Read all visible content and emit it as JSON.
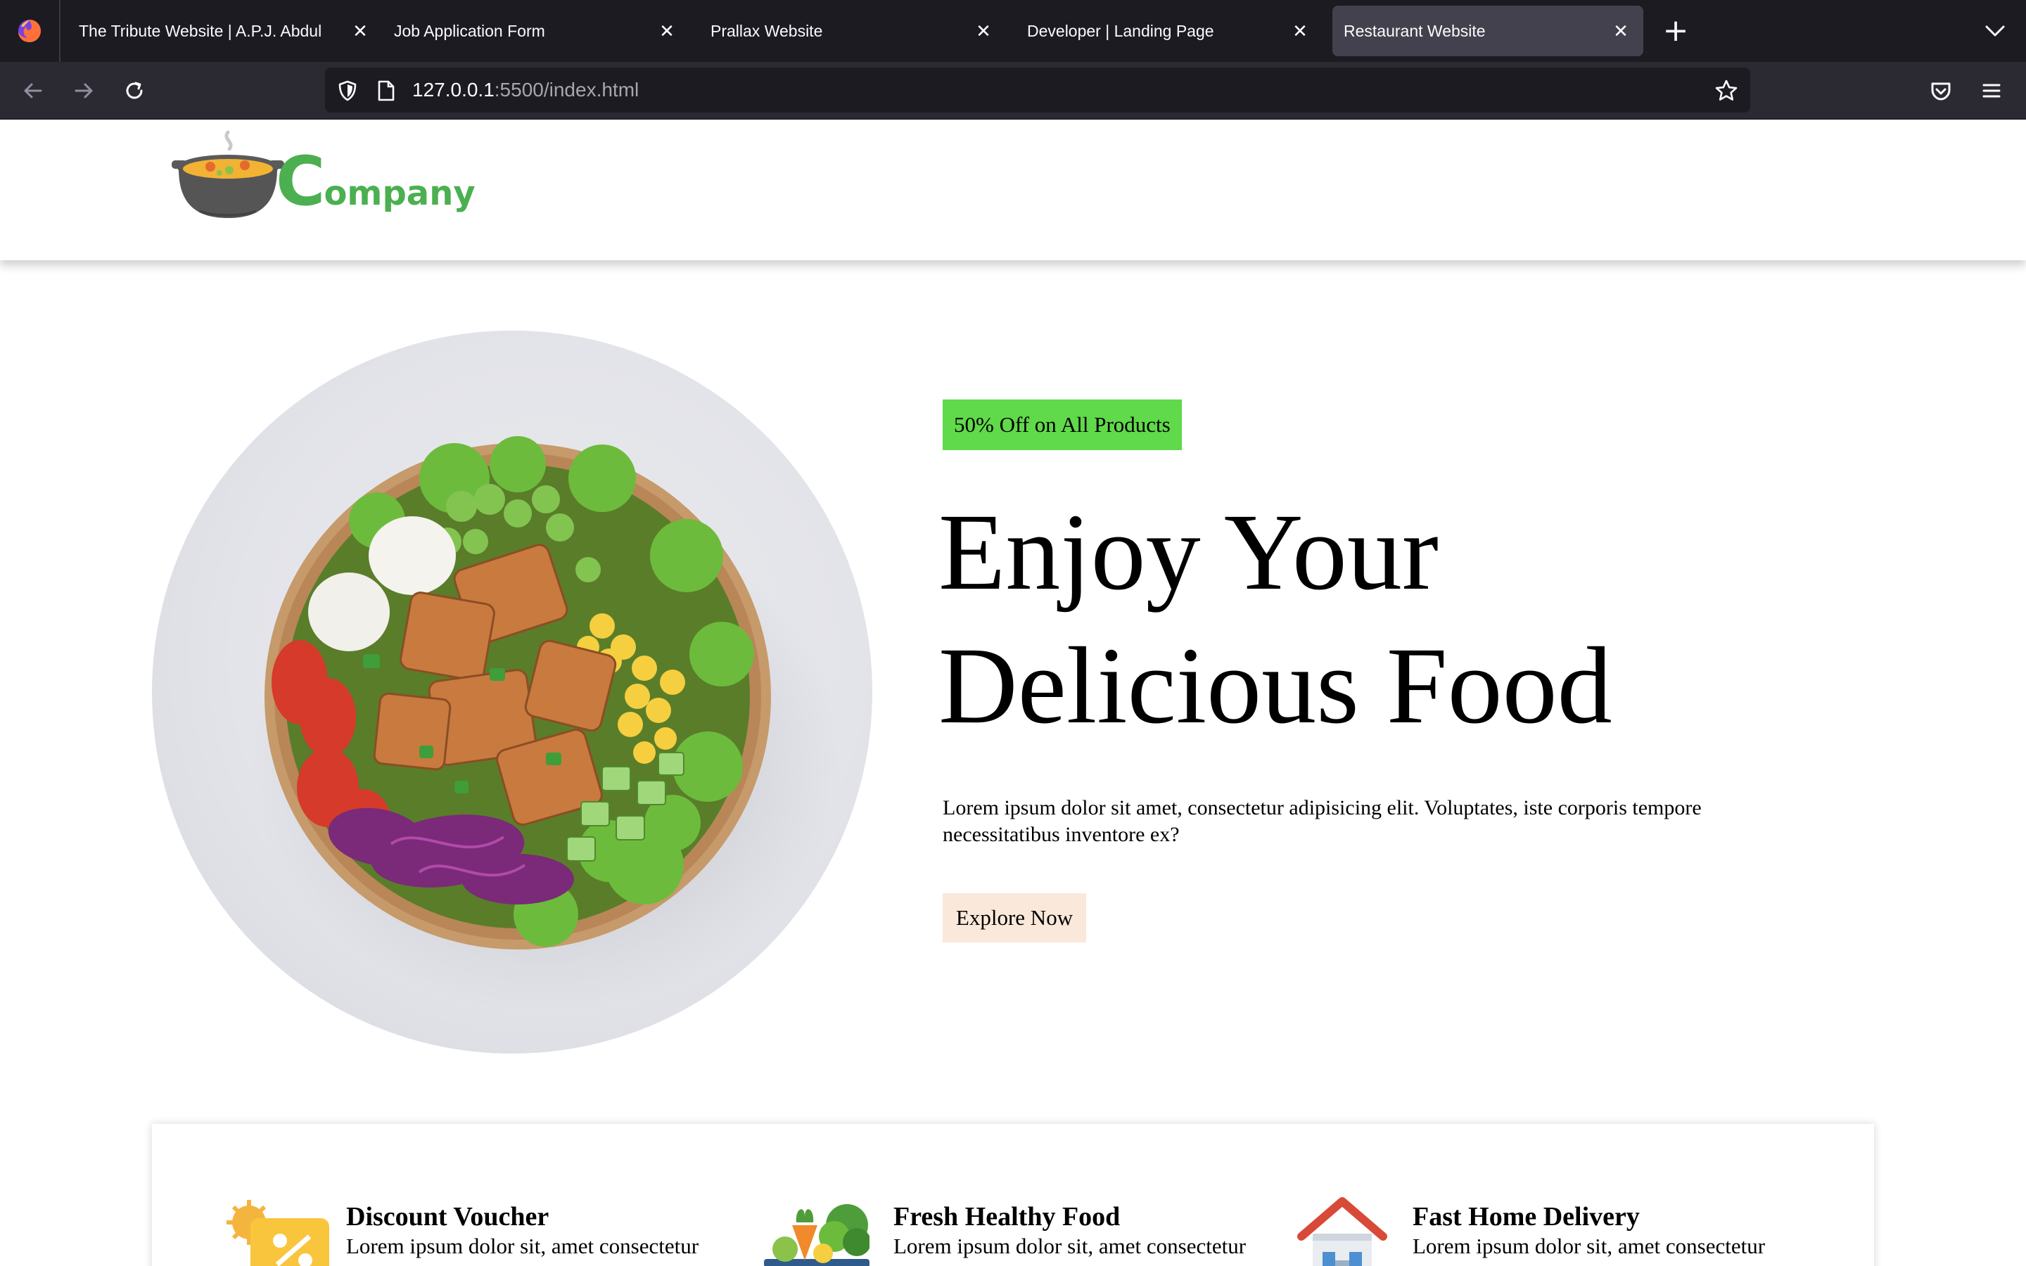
{
  "browser": {
    "tabs": [
      {
        "title": "The Tribute Website | A.P.J. Abdul Kalam",
        "active": false
      },
      {
        "title": "Job Application Form",
        "active": false
      },
      {
        "title": "Prallax Website",
        "active": false
      },
      {
        "title": "Developer | Landing Page",
        "active": false
      },
      {
        "title": "Restaurant Website",
        "active": true
      }
    ],
    "url_host": "127.0.0.1",
    "url_rest": ":5500/index.html"
  },
  "header": {
    "logo_first_letter": "C",
    "logo_rest": "ompany"
  },
  "hero": {
    "promo_badge": "50% Off on All Products",
    "headline_line1": "Enjoy Your",
    "headline_line2": "Delicious Food",
    "description": "Lorem ipsum dolor sit amet, consectetur adipisicing elit. Voluptates, iste corporis tempore necessitatibus inventore ex?",
    "cta_label": "Explore Now"
  },
  "features": [
    {
      "title": "Discount Voucher",
      "text": "Lorem ipsum dolor sit, amet consectetur",
      "icon": "voucher-icon"
    },
    {
      "title": "Fresh Healthy Food",
      "text": "Lorem ipsum dolor sit, amet consectetur",
      "icon": "vegetables-icon"
    },
    {
      "title": "Fast Home Delivery",
      "text": "Lorem ipsum dolor sit, amet consectetur",
      "icon": "home-icon"
    }
  ],
  "colors": {
    "promo_badge_bg": "#60d94a",
    "cta_bg": "#fae8da",
    "logo_green": "#4caf50",
    "browser_tab_bar": "#1c1b22",
    "browser_toolbar": "#2b2a33"
  }
}
